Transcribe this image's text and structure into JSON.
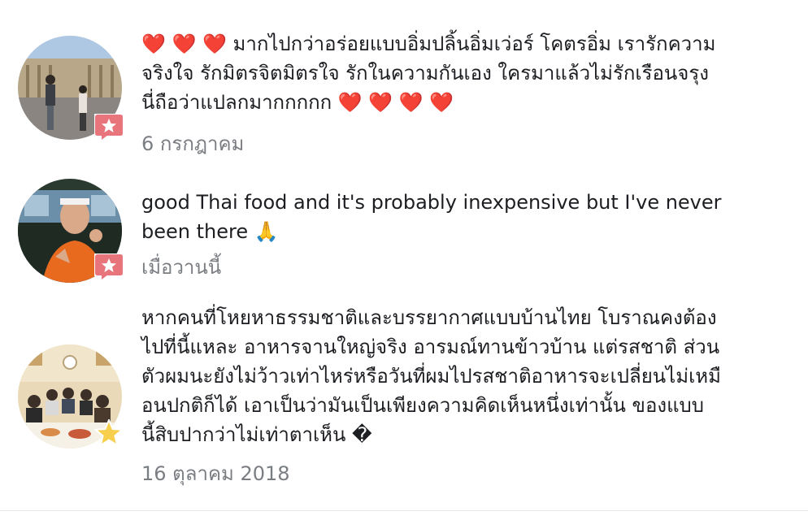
{
  "reviews": [
    {
      "text": "❤️ ❤️ ❤️ มากไปกว่าอร่อยแบบอิ่มปลิ้นอิ่มเว่อร์ โคตรอิ่ม เรารักความ\nจริงใจ รักมิตรจิตมิตรใจ รักในความกันเอง ใครมาแล้วไม่รักเรือนจรุง\nนี่ถือว่าแปลกมากกกกก ❤️ ❤️ ❤️ ❤️",
      "date": "6 กรกฎาคม",
      "badge": "recommend-star-badge",
      "badge_color": "#e8747c",
      "avatar": "palace-courtyard-photo"
    },
    {
      "text": "good Thai food and it's probably inexpensive but I've never\nbeen there 🙏",
      "date": "เมื่อวานนี้",
      "badge": "recommend-star-badge",
      "badge_color": "#e8747c",
      "avatar": "man-selfie-photo"
    },
    {
      "text": "หากคนที่โหยหาธรรมชาติและบรรยากาศแบบบ้านไทย โบราณคงต้อง\nไปที่นี้แหละ อาหารจานใหญ่จริง อารมณ์ทานข้าวบ้าน แต่รสชาติ ส่วน\nตัวผมนะยังไม่ว้าวเท่าไหร่หรือวันที่ผมไปรสชาติอาหารจะเปลี่ยนไม่เหมื\nอนปกติก็ได้ เอาเป็นว่ามันเป็นเพียงความคิดเห็นหนึ่งเท่านั้น ของแบบ\nนี้สิบปากว่าไม่เท่าตาเห็น �",
      "date": "16 ตุลาคม 2018",
      "badge": "yellow-star-badge",
      "badge_color": "#f7cf4d",
      "avatar": "group-dinner-photo"
    }
  ]
}
